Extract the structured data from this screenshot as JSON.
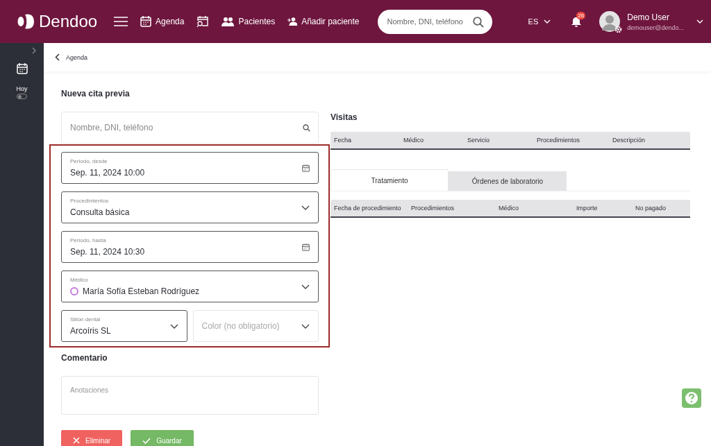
{
  "header": {
    "logo": "Dendoo",
    "nav": [
      {
        "kind": "calendar",
        "label": "Agenda"
      },
      {
        "kind": "calendar-search"
      },
      {
        "kind": "people",
        "label": "Pacientes"
      },
      {
        "kind": "add-person",
        "label": "Añadir paciente"
      }
    ],
    "search": {
      "placeholder": "Nombre, DNI, teléfono"
    },
    "language": "ES",
    "notifications": "26",
    "user": {
      "name": "Demo User",
      "email": "demouser@dendo..."
    }
  },
  "sidebar": {
    "today_label": "Hoy",
    "today_on": false
  },
  "breadcrumb": "Agenda",
  "form": {
    "title": "Nueva cita previa",
    "patient_search": {
      "placeholder": "Nombre, DNI, teléfono"
    },
    "fields": [
      {
        "kind": "date",
        "label": "Periodo, desde",
        "value": "Sep. 11, 2024 10:00"
      },
      {
        "kind": "select",
        "label": "Procedimientos",
        "value": "Consulta básica"
      },
      {
        "kind": "date",
        "label": "Periodo, hasta",
        "value": "Sep. 11, 2024 10:30"
      },
      {
        "kind": "select",
        "label": "Médico",
        "value": "María Sofía Esteban Rodríguez",
        "color": "#c77ddf"
      }
    ],
    "half_fields": [
      {
        "kind": "select",
        "label": "Sillón dental",
        "value": "Arcoíris SL"
      },
      {
        "kind": "select",
        "placeholder": "Color (no obligatorio)"
      }
    ],
    "comment": {
      "title": "Comentario",
      "placeholder": "Anotaciones"
    },
    "buttons": [
      {
        "kind": "delete",
        "label": "Eliminar"
      },
      {
        "kind": "save",
        "label": "Guardar"
      }
    ]
  },
  "visits": {
    "title": "Visitas",
    "columns": [
      "Fecha",
      "Médico",
      "Servicio",
      "Procedimientos",
      "Descripción"
    ]
  },
  "tabs": [
    {
      "label": "Tratamiento",
      "selected": true
    },
    {
      "label": "Órdenes de laboratorio",
      "selected": false
    }
  ],
  "treatment": {
    "columns": [
      "Fecha de procedimiento",
      "Procedimientos",
      "Médico",
      "Importe",
      "No pagado"
    ]
  }
}
